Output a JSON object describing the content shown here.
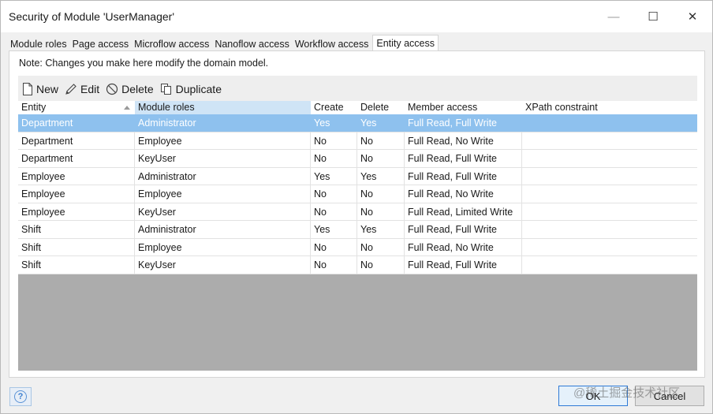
{
  "window": {
    "title": "Security of Module 'UserManager'",
    "controls": {
      "minimize": "—",
      "maximize": "☐",
      "close": "✕"
    }
  },
  "tabs": [
    {
      "label": "Module roles",
      "active": false
    },
    {
      "label": "Page access",
      "active": false
    },
    {
      "label": "Microflow access",
      "active": false
    },
    {
      "label": "Nanoflow access",
      "active": false
    },
    {
      "label": "Workflow access",
      "active": false
    },
    {
      "label": "Entity access",
      "active": true
    }
  ],
  "note": "Note: Changes you make here modify the domain model.",
  "toolbar": {
    "new_label": "New",
    "edit_label": "Edit",
    "delete_label": "Delete",
    "duplicate_label": "Duplicate"
  },
  "table": {
    "columns": [
      "Entity",
      "Module roles",
      "Create",
      "Delete",
      "Member access",
      "XPath constraint"
    ],
    "sorted_column": "Entity",
    "rows": [
      {
        "entity": "Department",
        "role": "Administrator",
        "create": "Yes",
        "delete": "Yes",
        "member": "Full Read, Full Write",
        "xpath": "",
        "selected": true
      },
      {
        "entity": "Department",
        "role": "Employee",
        "create": "No",
        "delete": "No",
        "member": "Full Read, No Write",
        "xpath": "",
        "selected": false
      },
      {
        "entity": "Department",
        "role": "KeyUser",
        "create": "No",
        "delete": "No",
        "member": "Full Read, Full Write",
        "xpath": "",
        "selected": false
      },
      {
        "entity": "Employee",
        "role": "Administrator",
        "create": "Yes",
        "delete": "Yes",
        "member": "Full Read, Full Write",
        "xpath": "",
        "selected": false
      },
      {
        "entity": "Employee",
        "role": "Employee",
        "create": "No",
        "delete": "No",
        "member": "Full Read, No Write",
        "xpath": "",
        "selected": false
      },
      {
        "entity": "Employee",
        "role": "KeyUser",
        "create": "No",
        "delete": "No",
        "member": "Full Read, Limited Write",
        "xpath": "",
        "selected": false
      },
      {
        "entity": "Shift",
        "role": "Administrator",
        "create": "Yes",
        "delete": "Yes",
        "member": "Full Read, Full Write",
        "xpath": "",
        "selected": false
      },
      {
        "entity": "Shift",
        "role": "Employee",
        "create": "No",
        "delete": "No",
        "member": "Full Read, No Write",
        "xpath": "",
        "selected": false
      },
      {
        "entity": "Shift",
        "role": "KeyUser",
        "create": "No",
        "delete": "No",
        "member": "Full Read, Full Write",
        "xpath": "",
        "selected": false
      }
    ]
  },
  "footer": {
    "help_label": "?",
    "ok_label": "OK",
    "cancel_label": "Cancel",
    "watermark": "@稀土掘金技术社区"
  },
  "colors": {
    "selection": "#8ec1ee",
    "sorted_header": "#cfe4f6",
    "grid_empty": "#acacac",
    "ok_border": "#2f7ad6"
  },
  "icons": {
    "new": "new-document-icon",
    "edit": "pencil-icon",
    "delete": "prohibited-icon",
    "duplicate": "duplicate-icon",
    "sort": "sort-ascending-icon",
    "help": "help-icon"
  }
}
